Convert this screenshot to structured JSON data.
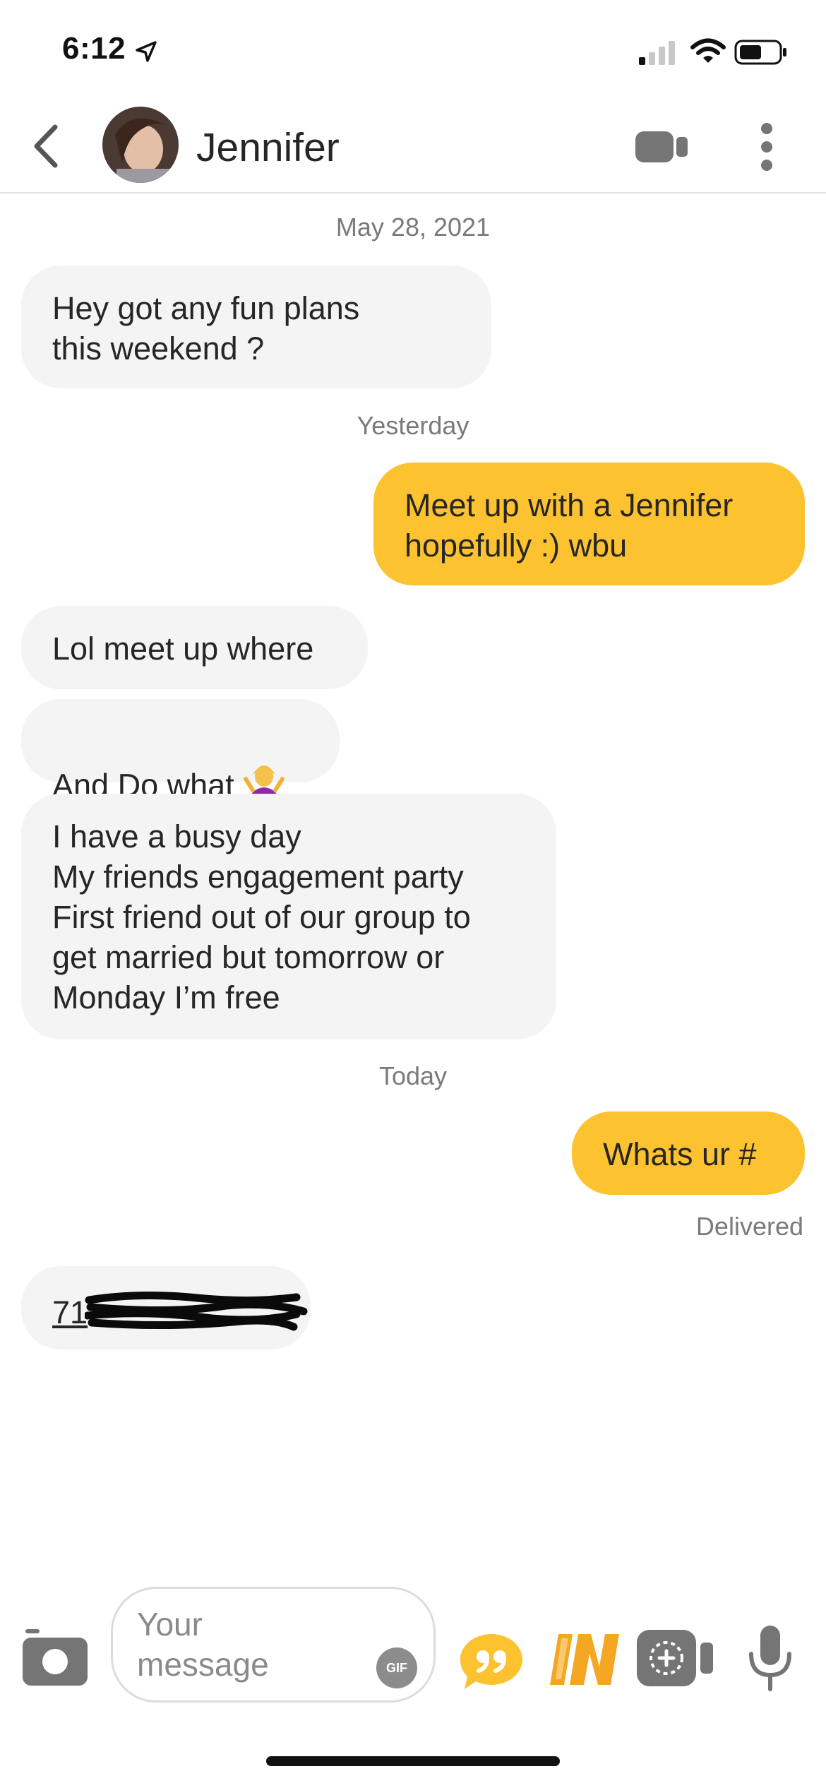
{
  "status_bar": {
    "time": "6:12"
  },
  "header": {
    "contact_name": "Jennifer"
  },
  "messages": {
    "date1": "May 28, 2021",
    "m1": "Hey got any fun plans\nthis weekend ?",
    "date2": "Yesterday",
    "m2": "Meet up with a Jennifer\nhopefully :) wbu",
    "m3": "Lol meet up where",
    "m4": "And Do what",
    "m5": "I have a busy day\nMy friends engagement party\nFirst friend out of our group to\nget married but tomorrow or\nMonday I’m free",
    "date3": "Today",
    "m6": "Whats ur #",
    "delivered": "Delivered",
    "m7": "71"
  },
  "input_bar": {
    "placeholder": "Your\nmessage",
    "gif_label": "GIF"
  },
  "icons": {
    "location": "location-arrow-icon",
    "signal": "cellular-signal-icon",
    "wifi": "wifi-icon",
    "battery": "battery-icon",
    "back": "chevron-left-icon",
    "video": "video-camera-icon",
    "more": "vertical-dots-icon",
    "shrug_emoji": "person-shrugging-emoji",
    "camera": "camera-icon",
    "quote": "quote-icon",
    "in_badge": "in-badge-icon",
    "add_media": "add-media-icon",
    "mic": "microphone-icon"
  },
  "colors": {
    "outgoing_bubble": "#fdc22f",
    "incoming_bubble": "#f4f4f4",
    "icon_gray": "#8c8c8c"
  }
}
